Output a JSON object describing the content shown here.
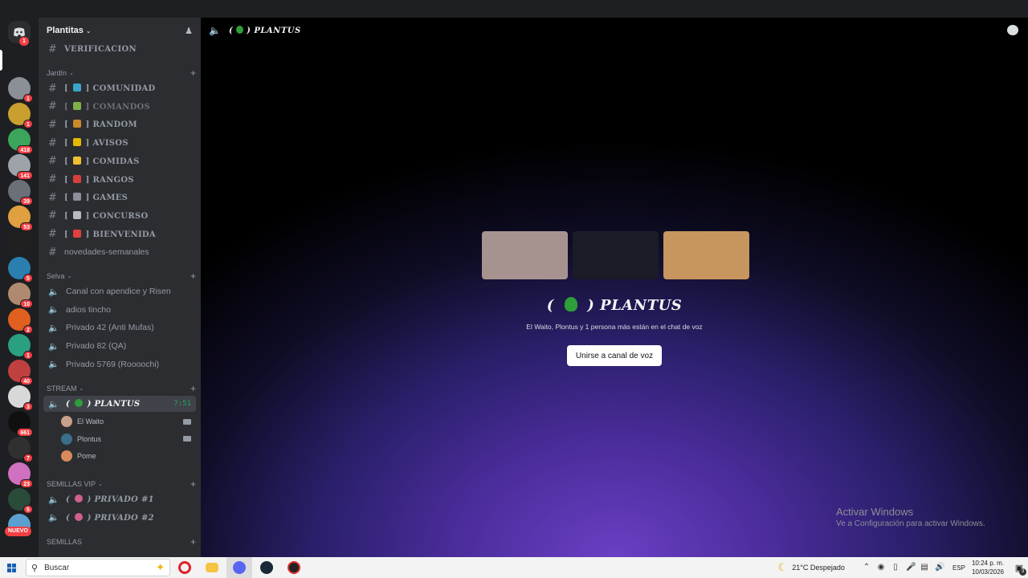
{
  "server": {
    "name": "Plantitas"
  },
  "top_channel": {
    "label": "VERIFICACION"
  },
  "categories": {
    "jardin": "Jardín",
    "selva": "Selva",
    "stream": "STREAM",
    "semillas_vip": "SEMILLAS VIP",
    "semillas": "SEMILLAS"
  },
  "jardin_channels": [
    {
      "label": "COMUNIDAD",
      "emoji_color": "#3aa5c8"
    },
    {
      "label": "COMANDOS",
      "emoji_color": "#7fb04a"
    },
    {
      "label": "RANDOM",
      "emoji_color": "#c98a2a"
    },
    {
      "label": "AVISOS",
      "emoji_color": "#e6b800"
    },
    {
      "label": "COMIDAS",
      "emoji_color": "#f0c030"
    },
    {
      "label": "RANGOS",
      "emoji_color": "#d6403a"
    },
    {
      "label": "GAMES",
      "emoji_color": "#8a8f98"
    },
    {
      "label": "CONCURSO",
      "emoji_color": "#b7bcc3"
    },
    {
      "label": "BIENVENIDA",
      "emoji_color": "#e04040"
    },
    {
      "label": "novedades-semanales"
    }
  ],
  "selva_channels": [
    "Canal con apendice y Risen",
    "adios tincho",
    "Privado 42 (Anti Mufas)",
    "Privado 82 (QA)",
    "Privado 5769 (Roooochi)"
  ],
  "stream_channel": {
    "label": "PLANTUS",
    "timer": "7:51"
  },
  "voice_users": [
    {
      "name": "El Waito",
      "avatar_color": "#c9a08a",
      "camera": true
    },
    {
      "name": "Plontus",
      "avatar_color": "#3b6e8a",
      "camera": true
    },
    {
      "name": "Pome",
      "avatar_color": "#d88a5a",
      "camera": false
    }
  ],
  "vip_channels": [
    "PRIVADO #1",
    "PRIVADO #2"
  ],
  "rail": {
    "servers": [
      {
        "badge": "1",
        "color": "#8a8f98"
      },
      {
        "badge": "1",
        "color": "#c9a030"
      },
      {
        "badge": "418",
        "color": "#3ba55c"
      },
      {
        "badge": "141",
        "color": "#9ea3aa"
      },
      {
        "badge": "39",
        "color": "#6a6f78"
      },
      {
        "badge": "53",
        "color": "#e0a040"
      },
      {
        "badge": "",
        "color": "#202020"
      },
      {
        "badge": "5",
        "color": "#2a7fb0"
      },
      {
        "badge": "10",
        "color": "#b08a70"
      },
      {
        "badge": "2",
        "color": "#e06020"
      },
      {
        "badge": "1",
        "color": "#2aa080"
      },
      {
        "badge": "40",
        "color": "#c04040"
      },
      {
        "badge": "3",
        "color": "#d8d8d8"
      },
      {
        "badge": "661",
        "color": "#101010"
      },
      {
        "badge": "7",
        "color": "#303030"
      },
      {
        "badge": "23",
        "color": "#d070c0"
      },
      {
        "badge": "5",
        "color": "#2a4a3a"
      },
      {
        "badge": "",
        "color": "#5aa0d0"
      }
    ],
    "home_badge": "1",
    "new_label": "NUEVO"
  },
  "main": {
    "header_title": "PLANTUS",
    "voice_title": "PLANTUS",
    "subtitle": "El Waito, Plontus y 1 persona más están en el chat de voz",
    "join_button": "Unirse a canal de voz",
    "tiles": [
      "#a6938f",
      "#1a1c26",
      "#c7955e"
    ]
  },
  "watermark": {
    "line1": "Activar Windows",
    "line2": "Ve a Configuración para activar Windows."
  },
  "taskbar": {
    "search_placeholder": "Buscar",
    "weather": "21°C  Despejado",
    "lang": "ESP",
    "time": "10:24 p. m.",
    "date": "10/03/2026",
    "notif_count": "3"
  }
}
